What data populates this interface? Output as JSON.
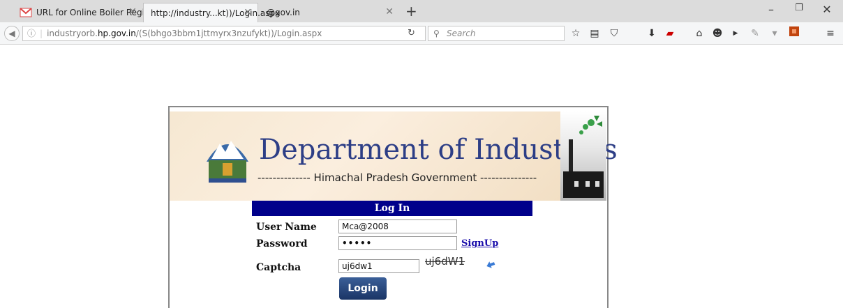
{
  "browser": {
    "tabs": [
      {
        "title": "URL for Online Boiler Regi..."
      },
      {
        "title": "http://industry...kt))/Login.aspx"
      },
      {
        "title": "@gov.in"
      }
    ],
    "url": {
      "prefix": "industryorb.",
      "host": "hp.gov.in",
      "path": "/(S(bhgo3bbm1jttmyrx3nzufykt))/Login.aspx"
    },
    "search_placeholder": "Search"
  },
  "page": {
    "department_title": "Department of Industries",
    "department_subtitle": "-------------- Himachal Pradesh Government ---------------",
    "login_header": "Log In",
    "username_label": "User Name",
    "username_value": "Mca@2008",
    "password_label": "Password",
    "password_value": "•••••",
    "signup_label": "SignUp",
    "captcha_label": "Captcha",
    "captcha_value": "uj6dw1",
    "captcha_image_text": "uj6dW1",
    "login_button": "Login"
  },
  "colors": {
    "header_blue": "#00008b",
    "title_blue": "#2d3e86",
    "link_blue": "#1a0dab"
  }
}
